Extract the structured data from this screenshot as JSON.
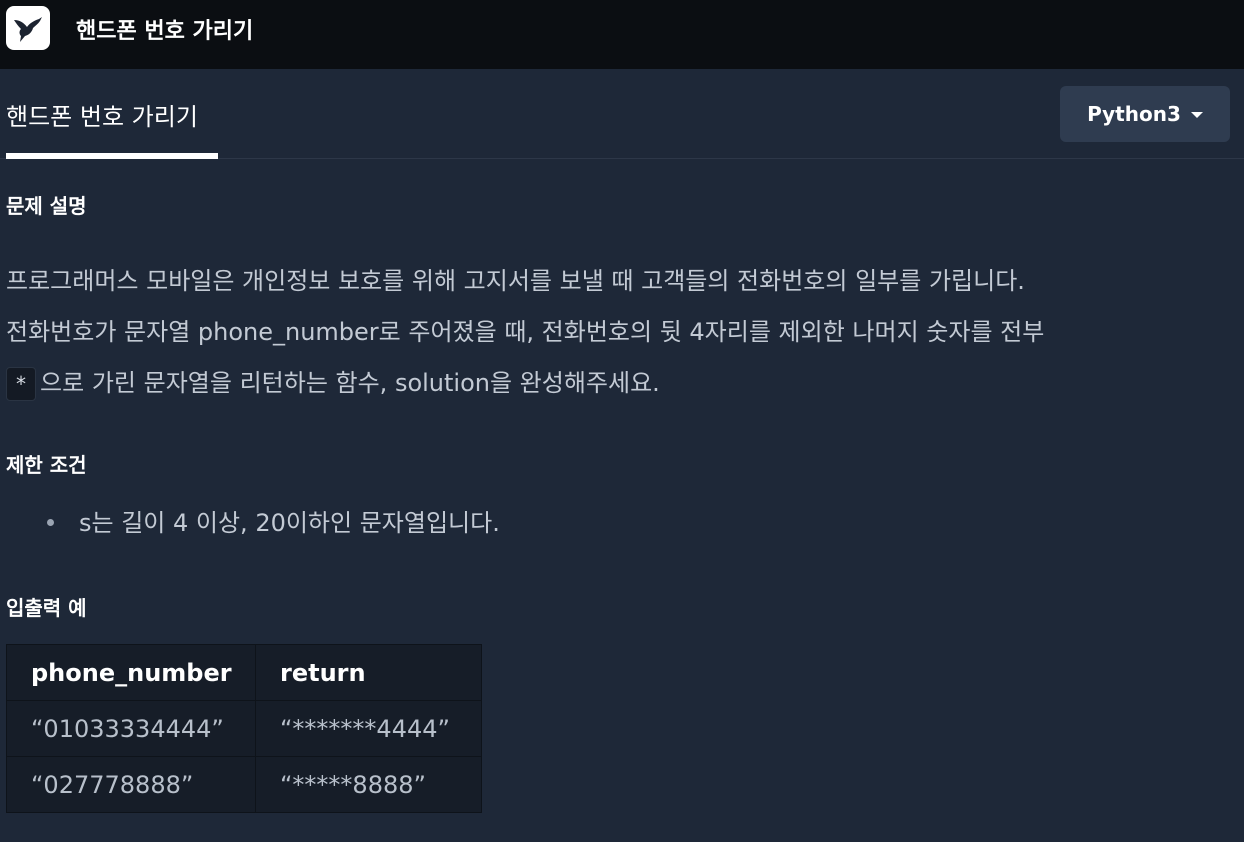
{
  "topbar": {
    "logo_icon": "hummingbird-logo-icon",
    "title": "핸드폰 번호 가리기"
  },
  "tabs": [
    {
      "label": "핸드폰 번호 가리기",
      "active": true
    }
  ],
  "language_select": {
    "value": "Python3",
    "icon": "caret-down-icon"
  },
  "sections": {
    "description_heading": "문제 설명",
    "description_line1": "프로그래머스 모바일은 개인정보 보호를 위해 고지서를 보낼 때 고객들의 전화번호의 일부를 가립니다.",
    "description_line2": "전화번호가 문자열 phone_number로 주어졌을 때, 전화번호의 뒷 4자리를 제외한 나머지 숫자를 전부",
    "description_code": "*",
    "description_line3": "으로 가린 문자열을 리턴하는 함수, solution을 완성해주세요.",
    "constraints_heading": "제한 조건",
    "constraints": [
      "s는 길이 4 이상, 20이하인 문자열입니다."
    ],
    "examples_heading": "입출력 예"
  },
  "examples_table": {
    "headers": [
      "phone_number",
      "return"
    ],
    "rows": [
      [
        "“01033334444”",
        "“*******4444”"
      ],
      [
        "“027778888”",
        "“*****8888”"
      ]
    ]
  },
  "colors": {
    "background": "#1e2838",
    "topbar": "#0b0e12",
    "select_bg": "#2f3c50"
  }
}
